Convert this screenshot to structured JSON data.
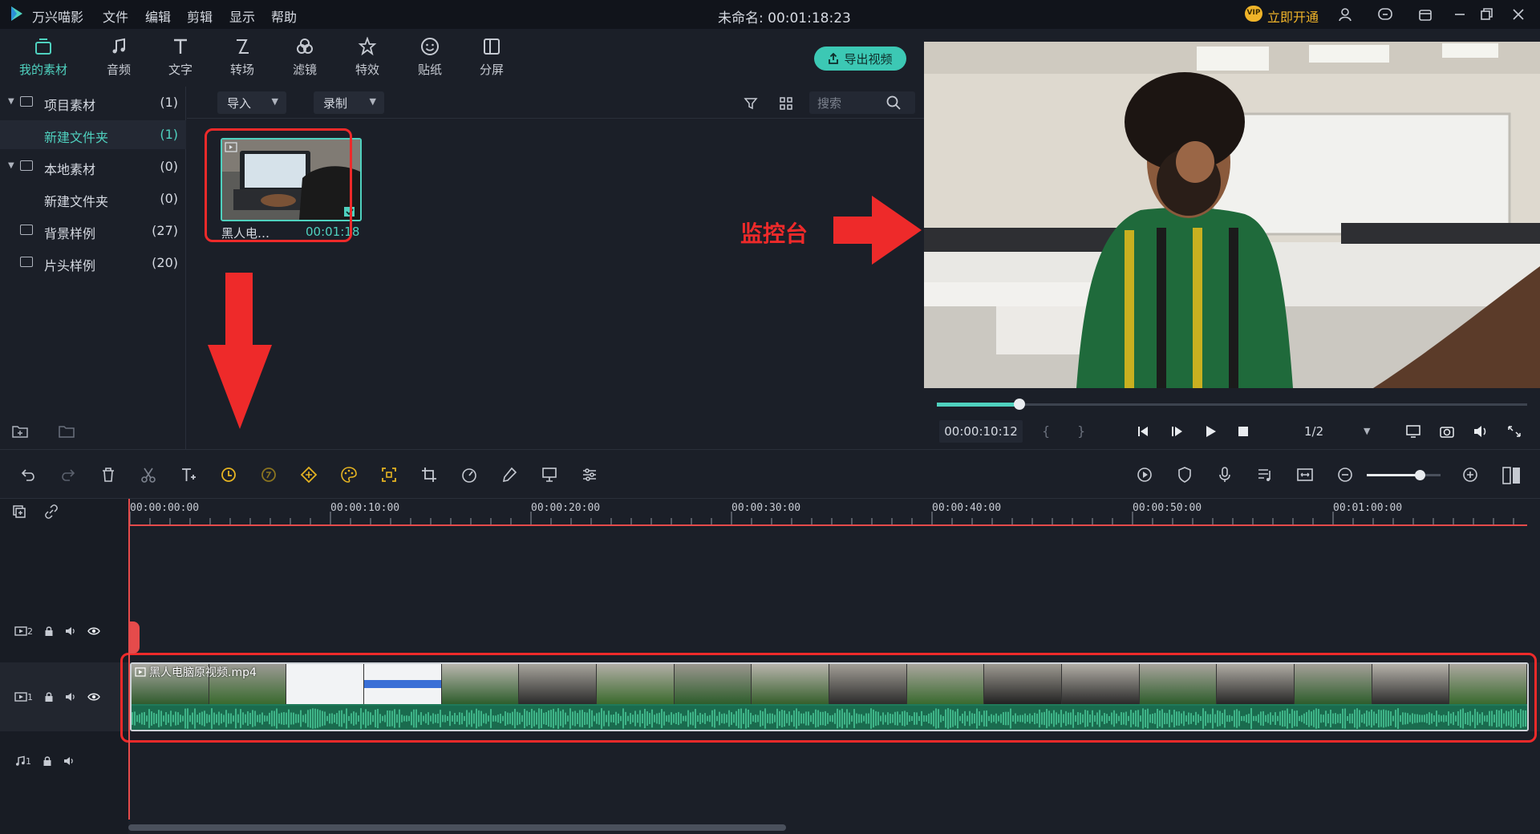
{
  "app": {
    "name": "万兴喵影",
    "menus": [
      "文件",
      "编辑",
      "剪辑",
      "显示",
      "帮助"
    ],
    "project_title": "未命名: 00:01:18:23",
    "vip_label": "立即开通",
    "vip_badge": "VIP"
  },
  "media_tabs": [
    {
      "label": "我的素材",
      "icon": "folder-media-icon",
      "active": true
    },
    {
      "label": "音频",
      "icon": "music-note-icon"
    },
    {
      "label": "文字",
      "icon": "text-icon"
    },
    {
      "label": "转场",
      "icon": "transition-icon"
    },
    {
      "label": "滤镜",
      "icon": "filter-icon"
    },
    {
      "label": "特效",
      "icon": "effects-icon"
    },
    {
      "label": "贴纸",
      "icon": "sticker-icon"
    },
    {
      "label": "分屏",
      "icon": "split-screen-icon"
    }
  ],
  "export_label": "导出视频",
  "library": [
    {
      "name": "项目素材",
      "count": "(1)",
      "expanded": true
    },
    {
      "name": "新建文件夹",
      "count": "(1)",
      "selected": true,
      "child": true
    },
    {
      "name": "本地素材",
      "count": "(0)",
      "expanded": true
    },
    {
      "name": "新建文件夹",
      "count": "(0)",
      "child": true
    },
    {
      "name": "背景样例",
      "count": "(27)"
    },
    {
      "name": "片头样例",
      "count": "(20)"
    }
  ],
  "media_bar": {
    "import_label": "导入",
    "record_label": "录制",
    "search_placeholder": "搜索"
  },
  "media_item": {
    "name": "黑人电…",
    "duration": "00:01:18"
  },
  "annotation": {
    "monitor_label": "监控台"
  },
  "player": {
    "timecode": "00:00:10:12",
    "progress": 0.14,
    "quality": "1/2",
    "brace_open": "{",
    "brace_close": "}"
  },
  "timeline": {
    "ruler": [
      "00:00:00:00",
      "00:00:10:00",
      "00:00:20:00",
      "00:00:30:00",
      "00:00:40:00",
      "00:00:50:00",
      "00:01:00:00"
    ],
    "tracks": [
      {
        "id": "2",
        "type": "video"
      },
      {
        "id": "1",
        "type": "video"
      },
      {
        "id": "1",
        "type": "audio"
      }
    ],
    "clip_name": "黑人电脑原视频.mp4",
    "zoom": 0.72
  },
  "colors": {
    "accent": "#4fd1bf",
    "annotation_red": "#ee2a2a",
    "playhead": "#e54b4b"
  }
}
